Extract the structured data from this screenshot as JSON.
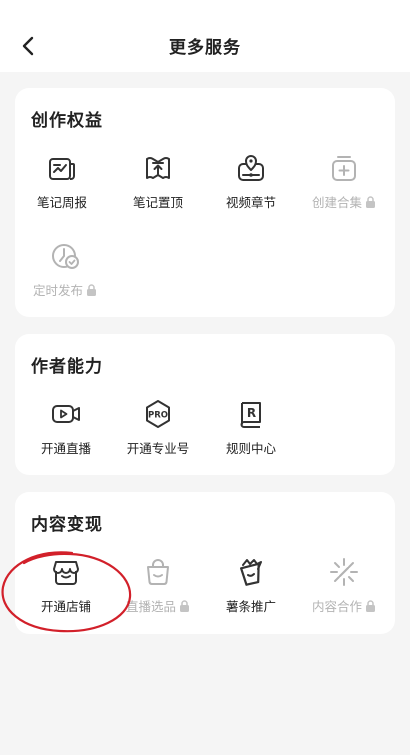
{
  "header": {
    "title": "更多服务"
  },
  "sections": [
    {
      "title": "创作权益",
      "items": [
        {
          "label": "笔记周报",
          "icon": "note-report-icon",
          "locked": false
        },
        {
          "label": "笔记置顶",
          "icon": "pin-top-icon",
          "locked": false
        },
        {
          "label": "视频章节",
          "icon": "video-chapter-icon",
          "locked": false
        },
        {
          "label": "创建合集",
          "icon": "create-collection-icon",
          "locked": true
        },
        {
          "label": "定时发布",
          "icon": "scheduled-publish-icon",
          "locked": true
        }
      ]
    },
    {
      "title": "作者能力",
      "items": [
        {
          "label": "开通直播",
          "icon": "live-video-icon",
          "locked": false
        },
        {
          "label": "开通专业号",
          "icon": "pro-badge-icon",
          "locked": false
        },
        {
          "label": "规则中心",
          "icon": "rules-book-icon",
          "locked": false
        }
      ]
    },
    {
      "title": "内容变现",
      "items": [
        {
          "label": "开通店铺",
          "icon": "shop-icon",
          "locked": false
        },
        {
          "label": "直播选品",
          "icon": "shopping-bag-icon",
          "locked": true
        },
        {
          "label": "薯条推广",
          "icon": "fries-promotion-icon",
          "locked": false
        },
        {
          "label": "内容合作",
          "icon": "sparkle-collab-icon",
          "locked": true
        }
      ]
    }
  ],
  "colors": {
    "active_icon": "#333333",
    "disabled": "#b3b3b3",
    "annotation": "#d2202a"
  }
}
